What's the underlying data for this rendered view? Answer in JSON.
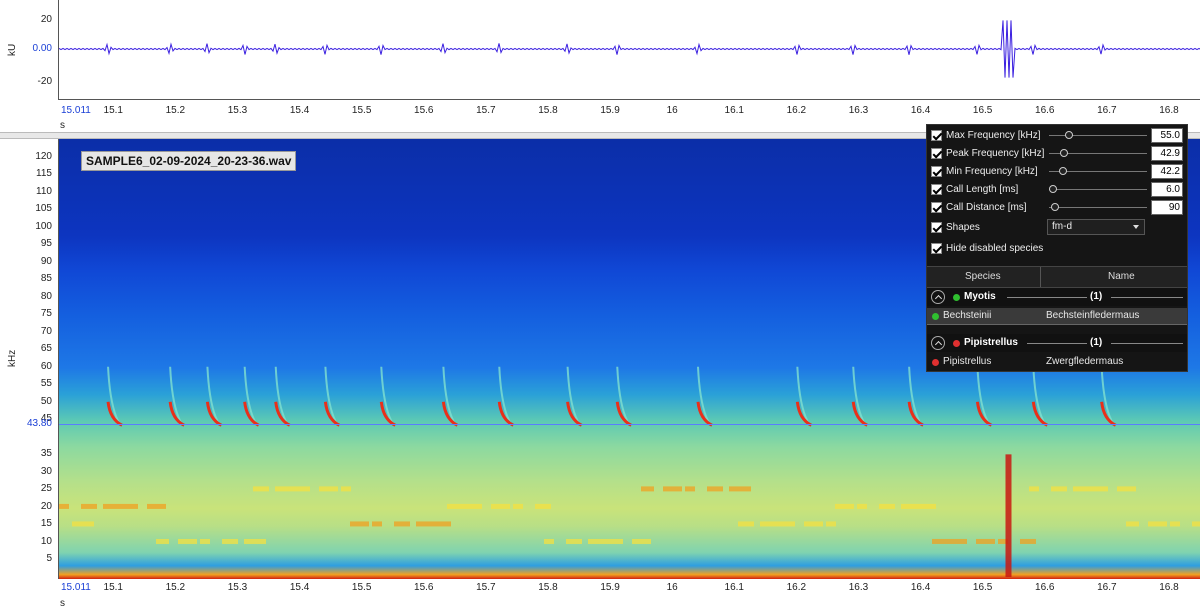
{
  "waveform": {
    "y_unit": "kU",
    "y_ticks": [
      "20",
      "0.00",
      "-20"
    ],
    "x_unit": "s",
    "x_start": "15.011",
    "x_ticks": [
      "15.1",
      "15.2",
      "15.3",
      "15.4",
      "15.5",
      "15.6",
      "15.7",
      "15.8",
      "15.9",
      "16",
      "16.1",
      "16.2",
      "16.3",
      "16.4",
      "16.5",
      "16.6",
      "16.7",
      "16.8"
    ],
    "trace_color": "#3a1fe0"
  },
  "spectrogram": {
    "filename": "SAMPLE6_02-09-2024_20-23-36.wav",
    "y_unit": "kHz",
    "y_ticks_upper": [
      "120",
      "115",
      "110",
      "105",
      "100",
      "95",
      "90",
      "85",
      "80",
      "75",
      "70",
      "65",
      "60",
      "55",
      "50",
      "45"
    ],
    "marker_value": "43.80",
    "y_ticks_lower": [
      "35",
      "30",
      "25",
      "20",
      "15",
      "10",
      "5"
    ],
    "x_unit": "s",
    "x_start": "15.011",
    "x_ticks": [
      "15.1",
      "15.2",
      "15.3",
      "15.4",
      "15.5",
      "15.6",
      "15.7",
      "15.8",
      "15.9",
      "16",
      "16.1",
      "16.2",
      "16.3",
      "16.4",
      "16.5",
      "16.6",
      "16.7",
      "16.8"
    ],
    "call_times": [
      15.09,
      15.19,
      15.25,
      15.31,
      15.36,
      15.44,
      15.53,
      15.63,
      15.72,
      15.83,
      15.91,
      16.04,
      16.2,
      16.29,
      16.38,
      16.49,
      16.58,
      16.69
    ]
  },
  "panel": {
    "params": [
      {
        "label": "Max Frequency [kHz]",
        "value": "55.0",
        "level": 0.18
      },
      {
        "label": "Peak Frequency [kHz]",
        "value": "42.9",
        "level": 0.12
      },
      {
        "label": "Min Frequency [kHz]",
        "value": "42.2",
        "level": 0.11
      },
      {
        "label": "Call Length [ms]",
        "value": "6.0",
        "level": 0.0
      },
      {
        "label": "Call Distance [ms]",
        "value": "90",
        "level": 0.02
      }
    ],
    "shapes_label": "Shapes",
    "shapes_value": "fm-d",
    "hide_disabled_label": "Hide disabled species",
    "table_headers": {
      "species": "Species",
      "name": "Name"
    },
    "groups": [
      {
        "name": "Myotis",
        "count": "(1)",
        "color": "#2fbf2f",
        "species": [
          {
            "species": "Bechsteinii",
            "name": "Bechsteinfledermaus",
            "color": "#2fbf2f"
          }
        ]
      },
      {
        "name": "Pipistrellus",
        "count": "(1)",
        "color": "#e03030",
        "species": [
          {
            "species": "Pipistrellus",
            "name": "Zwergfledermaus",
            "color": "#e03030"
          }
        ]
      }
    ]
  }
}
